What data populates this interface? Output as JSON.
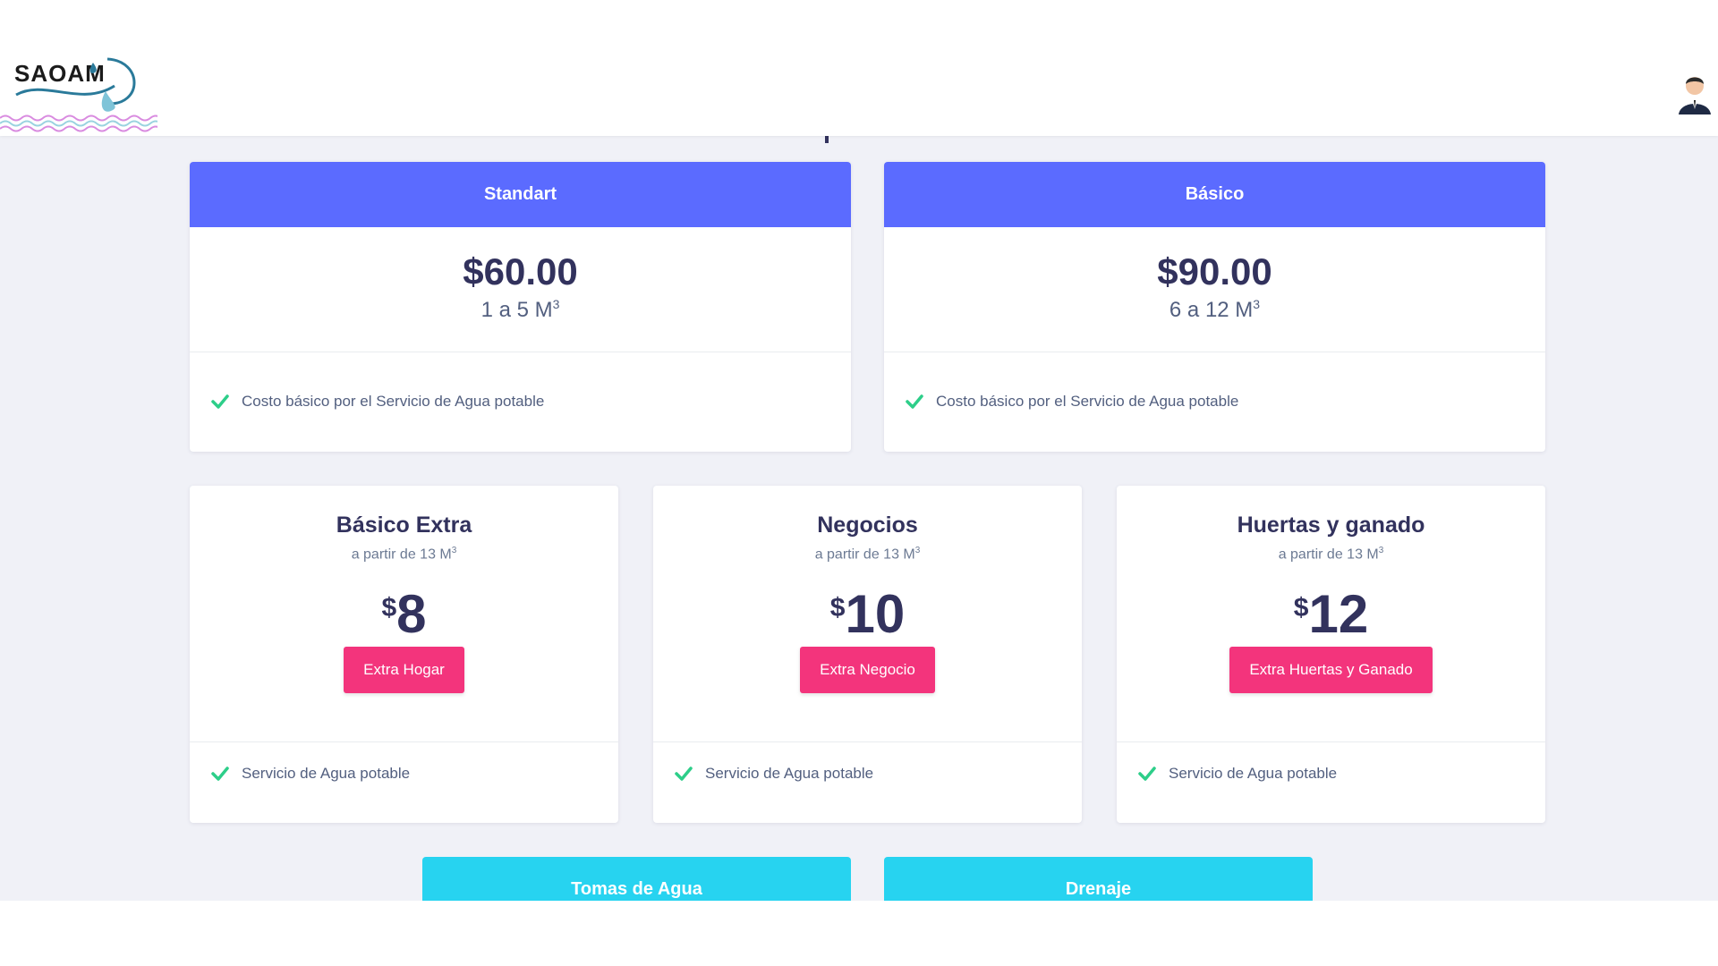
{
  "header": {
    "logo_text": "SAOAM",
    "logo_icon": "water-drop-wave-logo",
    "avatar_icon": "user-avatar-icon"
  },
  "colors": {
    "header_blue": "#5b6bff",
    "pink_button": "#f3347c",
    "cyan_card": "#27d3f0",
    "check_green": "#2dce89",
    "background": "#f0f1f7"
  },
  "plans": [
    {
      "title": "Standart",
      "price": "$60.00",
      "range": "1 a 5 M",
      "range_sup": "3",
      "feature": "Costo básico por el Servicio de Agua potable"
    },
    {
      "title": "Básico",
      "price": "$90.00",
      "range": "6 a 12 M",
      "range_sup": "3",
      "feature": "Costo básico por el Servicio de Agua potable"
    }
  ],
  "extras": [
    {
      "title": "Básico Extra",
      "subtitle": "a partir de 13 M",
      "subtitle_sup": "3",
      "currency": "$",
      "price": "8",
      "button": "Extra Hogar",
      "feature": "Servicio de Agua potable"
    },
    {
      "title": "Negocios",
      "subtitle": "a partir de 13 M",
      "subtitle_sup": "3",
      "currency": "$",
      "price": "10",
      "button": "Extra Negocio",
      "feature": "Servicio de Agua potable"
    },
    {
      "title": "Huertas y ganado",
      "subtitle": "a partir de 13 M",
      "subtitle_sup": "3",
      "currency": "$",
      "price": "12",
      "button": "Extra Huertas y Ganado",
      "feature": "Servicio de Agua potable"
    }
  ],
  "services": [
    {
      "title": "Tomas de Agua"
    },
    {
      "title": "Drenaje"
    }
  ]
}
